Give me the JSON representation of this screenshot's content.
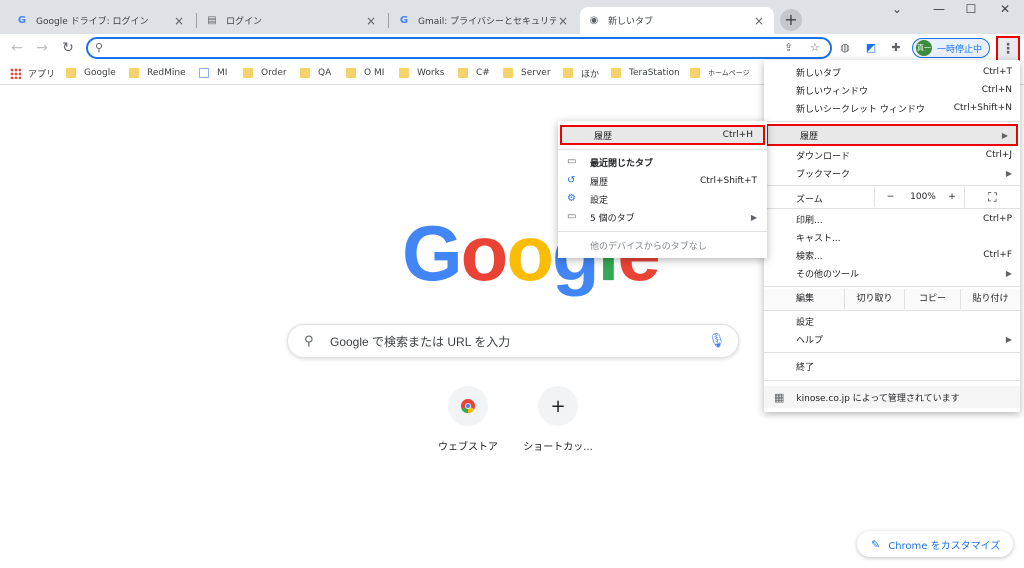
{
  "tabs": [
    {
      "title": "Google ドライブ: ログイン",
      "icon": "G"
    },
    {
      "title": "ログイン",
      "icon": "▤"
    },
    {
      "title": "Gmail: プライバシーとセキュリティを保護",
      "icon": "G"
    },
    {
      "title": "新しいタブ",
      "icon": "◉"
    }
  ],
  "newtab": "+",
  "omnibox": {
    "value": ""
  },
  "profile": {
    "avatar": "真一",
    "label": "一時停止中"
  },
  "bookmarks": [
    "アプリ",
    "Google",
    "RedMine",
    "MI",
    "Order",
    "QA",
    "O MI",
    "Works",
    "C#",
    "Server",
    "ほか",
    "TeraStation",
    "ホームページ"
  ],
  "search": {
    "placeholder": "Google で検索または URL を入力"
  },
  "shortcuts": [
    {
      "label": "ウェブストア",
      "icon": "chrome-webstore-icon"
    },
    {
      "label": "ショートカッ...",
      "icon": "+"
    }
  ],
  "customize": "Chrome をカスタマイズ",
  "menu": {
    "new_tab": {
      "label": "新しいタブ",
      "shortcut": "Ctrl+T"
    },
    "new_window": {
      "label": "新しいウィンドウ",
      "shortcut": "Ctrl+N"
    },
    "incognito": {
      "label": "新しいシークレット ウィンドウ",
      "shortcut": "Ctrl+Shift+N"
    },
    "history": {
      "label": "履歴"
    },
    "downloads": {
      "label": "ダウンロード",
      "shortcut": "Ctrl+J"
    },
    "bookmarks": {
      "label": "ブックマーク"
    },
    "zoom": {
      "label": "ズーム",
      "minus": "−",
      "value": "100%",
      "plus": "+"
    },
    "print": {
      "label": "印刷...",
      "shortcut": "Ctrl+P"
    },
    "cast": {
      "label": "キャスト..."
    },
    "find": {
      "label": "検索...",
      "shortcut": "Ctrl+F"
    },
    "more_tools": {
      "label": "その他のツール"
    },
    "edit": {
      "label": "編集",
      "cut": "切り取り",
      "copy": "コピー",
      "paste": "貼り付け"
    },
    "settings": {
      "label": "設定"
    },
    "help": {
      "label": "ヘルプ"
    },
    "exit": {
      "label": "終了"
    },
    "managed": "kinose.co.jp によって管理されています"
  },
  "history_submenu": {
    "history": {
      "label": "履歴",
      "shortcut": "Ctrl+H"
    },
    "recently_closed": {
      "label": "最近閉じたタブ"
    },
    "history_item": {
      "label": "履歴",
      "shortcut": "Ctrl+Shift+T"
    },
    "settings": {
      "label": "設定"
    },
    "five_tabs": {
      "label": "5 個のタブ"
    },
    "no_other_devices": {
      "label": "他のデバイスからのタブなし"
    }
  },
  "colors": {
    "accent": "#1a73e8",
    "highlight_border": "#ee0000",
    "g_blue": "#4285f4",
    "g_red": "#ea4335",
    "g_yellow": "#fbbc05",
    "g_green": "#34a853"
  }
}
